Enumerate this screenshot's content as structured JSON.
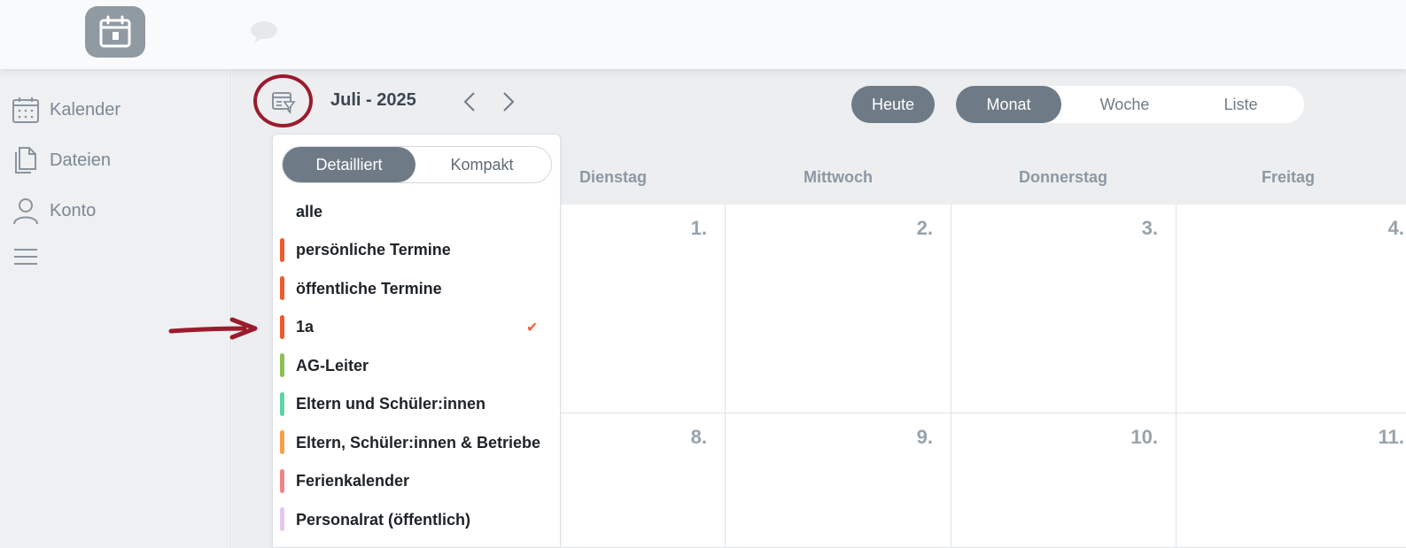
{
  "nav": {
    "items": [
      {
        "label": "Kalender",
        "icon": "calendar-icon"
      },
      {
        "label": "Dateien",
        "icon": "file-icon"
      },
      {
        "label": "Konto",
        "icon": "user-icon"
      }
    ],
    "menu_icon": "hamburger-menu-icon"
  },
  "toolbar": {
    "month": "Juli - 2025",
    "today_label": "Heute",
    "views": [
      "Monat",
      "Woche",
      "Liste"
    ],
    "active_view": "Monat"
  },
  "calendar": {
    "day_headers": [
      "Dienstag",
      "Mittwoch",
      "Donnerstag",
      "Freitag"
    ],
    "rows": [
      [
        "1.",
        "2.",
        "3.",
        "4."
      ],
      [
        "8.",
        "9.",
        "10.",
        "11."
      ]
    ]
  },
  "filter": {
    "modes": [
      "Detailliert",
      "Kompakt"
    ],
    "active_mode": "Detailliert",
    "options": [
      {
        "label": "alle",
        "color": null,
        "checked": false
      },
      {
        "label": "persönliche Termine",
        "color": "#ef5a2e",
        "checked": false
      },
      {
        "label": "öffentliche Termine",
        "color": "#ef5a2e",
        "checked": false
      },
      {
        "label": "1a",
        "color": "#ef5a2e",
        "checked": true
      },
      {
        "label": "AG-Leiter",
        "color": "#8cc152",
        "checked": false
      },
      {
        "label": "Eltern und Schüler:innen",
        "color": "#5fd3a5",
        "checked": false
      },
      {
        "label": "Eltern, Schüler:innen & Betriebe",
        "color": "#f6a04d",
        "checked": false
      },
      {
        "label": "Ferienkalender",
        "color": "#f08585",
        "checked": false
      },
      {
        "label": "Personalrat (öffentlich)",
        "color": "#e6c6ef",
        "checked": false
      }
    ]
  },
  "colors": {
    "accent": "#6e7b86",
    "annotation": "#9b1b2c"
  }
}
